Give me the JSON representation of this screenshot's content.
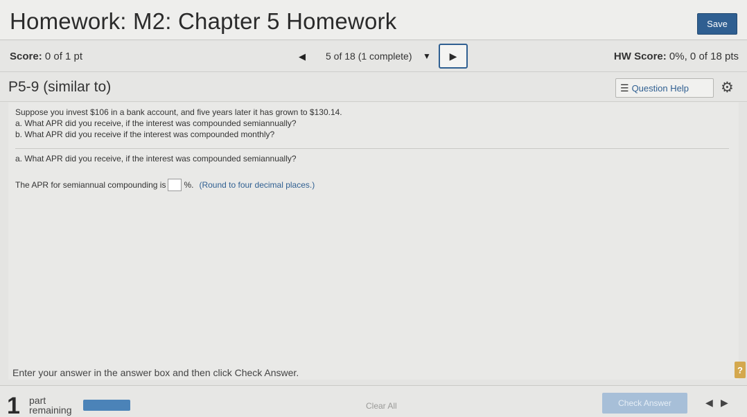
{
  "header": {
    "title": "Homework: M2: Chapter 5 Homework",
    "save_label": "Save"
  },
  "scorebar": {
    "score_label": "Score:",
    "score_value": "0 of 1 pt",
    "nav_prev_icon": "◀",
    "position": "5 of 18 (1 complete)",
    "dropdown_icon": "▼",
    "nav_next_icon": "▶",
    "hw_score_label": "HW Score:",
    "hw_score_value": "0%, 0 of 18 pts"
  },
  "question_bar": {
    "id": "P5-9 (similar to)",
    "help_icon": "☰",
    "help_label": "Question Help",
    "gear_icon": "⚙"
  },
  "problem": {
    "statement": "Suppose you invest $106 in a bank account, and five years later it has grown to $130.14.",
    "part_a": "a. What APR did you receive, if the interest was compounded semiannually?",
    "part_b": "b. What APR did you receive if the interest was compounded monthly?",
    "current_part": "a. What APR did you receive, if the interest was compounded semiannually?",
    "answer_prefix": "The APR for semiannual compounding is",
    "answer_value": "",
    "answer_suffix": "%.",
    "hint": "(Round to four decimal places.)"
  },
  "instruction": "Enter your answer in the answer box and then click Check Answer.",
  "footer": {
    "parts_count": "1",
    "parts_label_1": "part",
    "parts_label_2": "remaining",
    "progress_fraction": 1.0,
    "clear_all_label": "Clear All",
    "check_answer_label": "Check Answer",
    "prev_icon": "◀",
    "next_icon": "▶"
  },
  "help_badge": "?",
  "colors": {
    "accent": "#2f5f91",
    "progress_fill": "#4b83b8",
    "check_answer_disabled": "#a7bfd8",
    "help_badge": "#d4a84e"
  }
}
